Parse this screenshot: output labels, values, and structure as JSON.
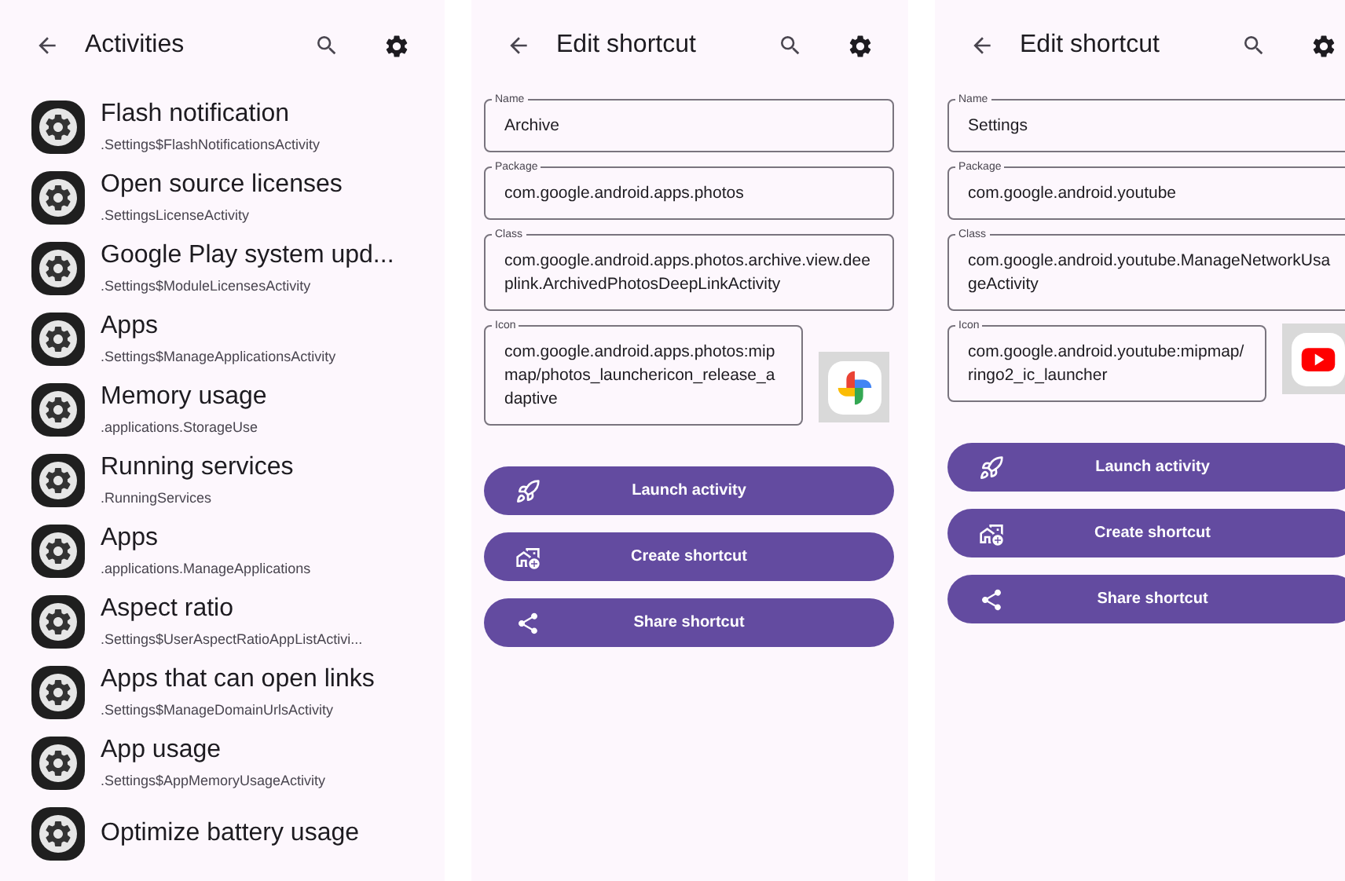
{
  "screens": [
    {
      "kind": "list",
      "title": "Activities",
      "items": [
        {
          "title": "Flash notification",
          "subtitle": ".Settings$FlashNotificationsActivity"
        },
        {
          "title": "Open source licenses",
          "subtitle": ".SettingsLicenseActivity"
        },
        {
          "title": "Google Play system upd...",
          "subtitle": ".Settings$ModuleLicensesActivity"
        },
        {
          "title": "Apps",
          "subtitle": ".Settings$ManageApplicationsActivity"
        },
        {
          "title": "Memory usage",
          "subtitle": ".applications.StorageUse"
        },
        {
          "title": "Running services",
          "subtitle": ".RunningServices"
        },
        {
          "title": "Apps",
          "subtitle": ".applications.ManageApplications"
        },
        {
          "title": "Aspect ratio",
          "subtitle": ".Settings$UserAspectRatioAppListActivi..."
        },
        {
          "title": "Apps that can open links",
          "subtitle": ".Settings$ManageDomainUrlsActivity"
        },
        {
          "title": "App usage",
          "subtitle": ".Settings$AppMemoryUsageActivity"
        },
        {
          "title": "Optimize battery usage"
        }
      ]
    },
    {
      "kind": "edit",
      "title": "Edit shortcut",
      "fields": [
        {
          "label": "Name",
          "value": "Archive"
        },
        {
          "label": "Package",
          "value": "com.google.android.apps.photos"
        },
        {
          "label": "Class",
          "value": "com.google.android.apps.photos.archive.view.deeplink.ArchivedPhotosDeepLinkActivity"
        },
        {
          "label": "Icon",
          "value": "com.google.android.apps.photos:mipmap/photos_launchericon_release_adaptive"
        }
      ],
      "icon_preview": {
        "kind": "pinwheel"
      },
      "buttons": [
        {
          "kind": "launch",
          "label": "Launch activity"
        },
        {
          "kind": "create",
          "label": "Create shortcut"
        },
        {
          "kind": "share",
          "label": "Share shortcut"
        }
      ]
    },
    {
      "kind": "edit",
      "title": "Edit shortcut",
      "fields": [
        {
          "label": "Name",
          "value": "Settings"
        },
        {
          "label": "Package",
          "value": "com.google.android.youtube"
        },
        {
          "label": "Class",
          "value": "com.google.android.youtube.ManageNetworkUsageActivity"
        },
        {
          "label": "Icon",
          "value": "com.google.android.youtube:mipmap/ringo2_ic_launcher"
        }
      ],
      "icon_preview": {
        "kind": "play"
      },
      "buttons": [
        {
          "kind": "launch",
          "label": "Launch activity"
        },
        {
          "kind": "create",
          "label": "Create shortcut"
        },
        {
          "kind": "share",
          "label": "Share shortcut"
        }
      ]
    }
  ]
}
